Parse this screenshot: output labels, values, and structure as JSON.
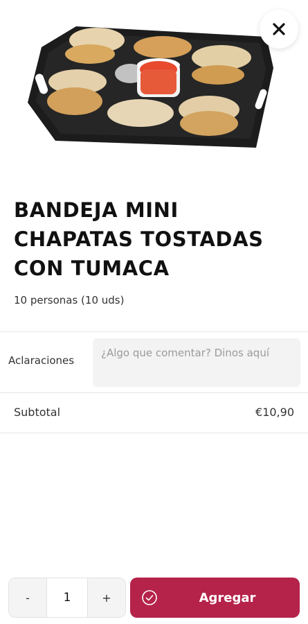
{
  "product": {
    "image_alt": "Bandeja con mini chapatas tostadas y tumaca",
    "title": "BANDEJA MINI CHAPATAS TOSTADAS CON TUMACA",
    "subtitle": "10 personas (10 uds)"
  },
  "header": {
    "close_icon": "close-icon"
  },
  "notes": {
    "label": "Aclaraciones",
    "placeholder": "¿Algo que comentar? Dinos aquí",
    "value": ""
  },
  "subtotal": {
    "label": "Subtotal",
    "value": "€10,90"
  },
  "cart": {
    "decrement_label": "-",
    "quantity": "1",
    "increment_label": "+",
    "add_label": "Agregar",
    "add_icon": "check-circle-icon"
  },
  "colors": {
    "accent": "#b5234a",
    "divider": "#e6e6e6",
    "input_bg": "#f3f3f3"
  }
}
